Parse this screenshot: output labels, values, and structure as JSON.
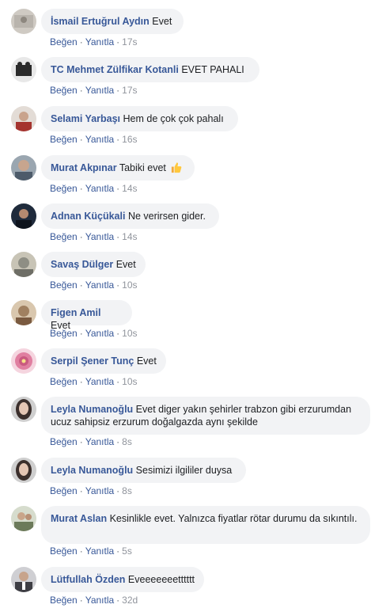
{
  "comments": [
    {
      "author": "İsmail Ertuğrul Aydın",
      "text": "Evet",
      "like_label": "Beğen",
      "reply_label": "Yanıtla",
      "time": "17s",
      "avatar_icon": "avatar-photo",
      "avatar_color": "#b9b4ad"
    },
    {
      "author": "TC Mehmet Zülfikar Kotanli",
      "text": "EVET PAHALI",
      "like_label": "Beğen",
      "reply_label": "Yanıtla",
      "time": "17s",
      "avatar_icon": "avatar-photo",
      "avatar_color": "#2b2b2b"
    },
    {
      "author": "Selami Yarbaşı",
      "text": "Hem de çok çok pahalı",
      "like_label": "Beğen",
      "reply_label": "Yanıtla",
      "time": "16s",
      "avatar_icon": "avatar-photo",
      "avatar_color": "#a5342f"
    },
    {
      "author": "Murat Akpınar",
      "text": "Tabiki evet",
      "emoji": "thumbs-up-icon",
      "like_label": "Beğen",
      "reply_label": "Yanıtla",
      "time": "14s",
      "avatar_icon": "avatar-photo",
      "avatar_color": "#4d5b6a"
    },
    {
      "author": "Adnan Küçükali",
      "text": "Ne verirsen gider.",
      "like_label": "Beğen",
      "reply_label": "Yanıtla",
      "time": "14s",
      "avatar_icon": "avatar-photo",
      "avatar_color": "#1f2b3c"
    },
    {
      "author": "Savaş Dülger",
      "text": "Evet",
      "like_label": "Beğen",
      "reply_label": "Yanıtla",
      "time": "10s",
      "avatar_icon": "avatar-photo",
      "avatar_color": "#8e8e84"
    },
    {
      "author": "Figen Amil",
      "text": "Evet",
      "like_label": "Beğen",
      "reply_label": "Yanıtla",
      "time": "10s",
      "avatar_icon": "avatar-photo",
      "avatar_color": "#a08060"
    },
    {
      "author": "Serpil Şener Tunç",
      "text": "Evet",
      "like_label": "Beğen",
      "reply_label": "Yanıtla",
      "time": "10s",
      "avatar_icon": "flower-avatar",
      "avatar_color": "#e07fa0"
    },
    {
      "author": "Leyla Numanoğlu",
      "text": "Evet diger yakın şehirler trabzon gibi erzurumdan ucuz sahipsiz erzurum doğalgazda aynı şekilde",
      "like_label": "Beğen",
      "reply_label": "Yanıtla",
      "time": "8s",
      "avatar_icon": "avatar-photo",
      "avatar_color": "#3b2f2c"
    },
    {
      "author": "Leyla Numanoğlu",
      "text": "Sesimizi ilgililer duysa",
      "like_label": "Beğen",
      "reply_label": "Yanıtla",
      "time": "8s",
      "avatar_icon": "avatar-photo",
      "avatar_color": "#3b2f2c"
    },
    {
      "author": "Murat Aslan",
      "text": "Kesinlikle evet. Yalnızca fiyatlar rötar durumu da sıkıntılı.",
      "like_label": "Beğen",
      "reply_label": "Yanıtla",
      "time": "5s",
      "avatar_icon": "avatar-photo",
      "avatar_color": "#6c7a5a"
    },
    {
      "author": "Lütfullah Özden",
      "text": "Eveeeeeeetttttt",
      "like_label": "Beğen",
      "reply_label": "Yanıtla",
      "time": "32d",
      "avatar_icon": "avatar-photo",
      "avatar_color": "#3e3e44"
    }
  ]
}
